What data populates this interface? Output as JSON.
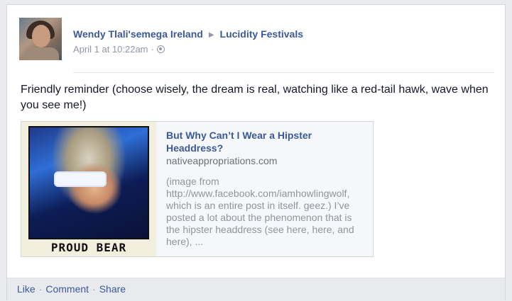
{
  "post": {
    "author": "Wendy Tlali'semega Ireland",
    "target": "Lucidity Festivals",
    "timestamp": "April 1 at 10:22am",
    "separator": "·",
    "privacy_icon": "globe-icon",
    "message": "Friendly reminder (choose wisely, the dream is real, watching like a red-tail hawk, wave when you see me!)"
  },
  "link_preview": {
    "title": "But Why Can’t I Wear a Hipster Headdress?",
    "domain": "nativeappropriations.com",
    "description": "(image from http://www.facebook.com/iamhowlingwolf, which is an entire post in itself. geez.) I’ve posted a lot about the phenomenon that is the hipster headdress (see here, here, and here), ...",
    "thumbnail_caption": "PROUD BEAR"
  },
  "actions": {
    "like": "Like",
    "comment": "Comment",
    "share": "Share",
    "separator": "·"
  },
  "colors": {
    "link": "#3b5998",
    "meta": "#9197a3",
    "background": "#e9ebee"
  }
}
